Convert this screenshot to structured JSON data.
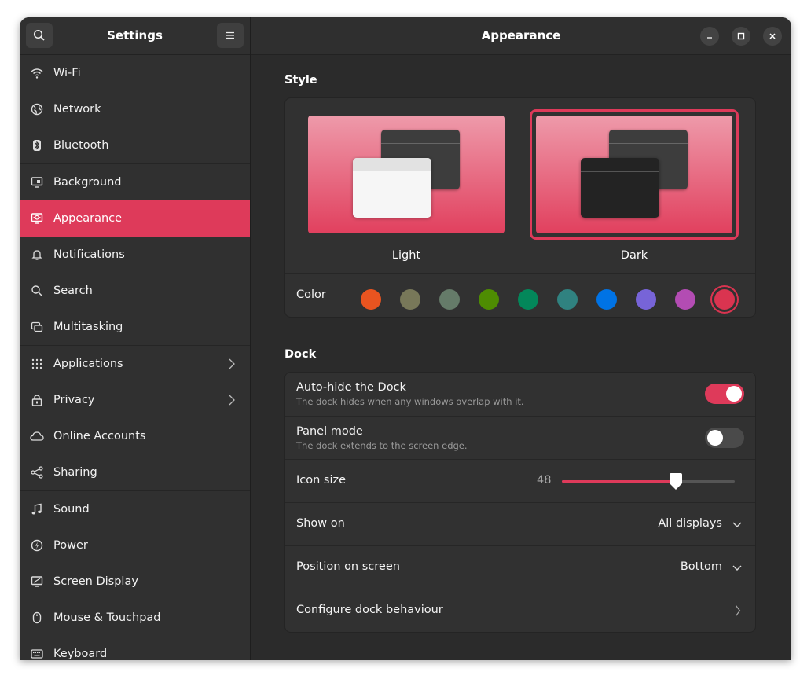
{
  "sidebar": {
    "title": "Settings",
    "items": [
      {
        "label": "Wi-Fi",
        "icon": "wifi-icon"
      },
      {
        "label": "Network",
        "icon": "globe-icon"
      },
      {
        "label": "Bluetooth",
        "icon": "bluetooth-icon"
      },
      {
        "label": "Background",
        "icon": "monitor-image-icon"
      },
      {
        "label": "Appearance",
        "icon": "appearance-icon",
        "active": true
      },
      {
        "label": "Notifications",
        "icon": "bell-icon"
      },
      {
        "label": "Search",
        "icon": "search-icon"
      },
      {
        "label": "Multitasking",
        "icon": "multitasking-icon"
      },
      {
        "label": "Applications",
        "icon": "grid-icon",
        "has_submenu": true
      },
      {
        "label": "Privacy",
        "icon": "lock-icon",
        "has_submenu": true
      },
      {
        "label": "Online Accounts",
        "icon": "cloud-icon"
      },
      {
        "label": "Sharing",
        "icon": "share-icon"
      },
      {
        "label": "Sound",
        "icon": "music-note-icon"
      },
      {
        "label": "Power",
        "icon": "power-icon"
      },
      {
        "label": "Screen Display",
        "icon": "display-icon"
      },
      {
        "label": "Mouse & Touchpad",
        "icon": "mouse-icon"
      },
      {
        "label": "Keyboard",
        "icon": "keyboard-icon"
      }
    ]
  },
  "main": {
    "title": "Appearance",
    "style": {
      "section_title": "Style",
      "options": [
        {
          "label": "Light",
          "selected": false
        },
        {
          "label": "Dark",
          "selected": true
        }
      ],
      "color_label": "Color",
      "colors": [
        "#e95420",
        "#787859",
        "#657b69",
        "#4e8c02",
        "#03875a",
        "#308280",
        "#0073e5",
        "#7764d8",
        "#b34cb3",
        "#da3450"
      ],
      "selected_color": "#da3450"
    },
    "dock": {
      "section_title": "Dock",
      "autohide": {
        "title": "Auto-hide the Dock",
        "subtitle": "The dock hides when any windows overlap with it.",
        "on": true
      },
      "panel_mode": {
        "title": "Panel mode",
        "subtitle": "The dock extends to the screen edge.",
        "on": false
      },
      "icon_size": {
        "title": "Icon size",
        "value": "48",
        "fraction": 0.66
      },
      "show_on": {
        "title": "Show on",
        "value": "All displays"
      },
      "position": {
        "title": "Position on screen",
        "value": "Bottom"
      },
      "configure": {
        "title": "Configure dock behaviour"
      }
    }
  },
  "colors": {
    "accent": "#de3a5a",
    "background": "#2b2b2b",
    "sidebar": "#303030"
  }
}
